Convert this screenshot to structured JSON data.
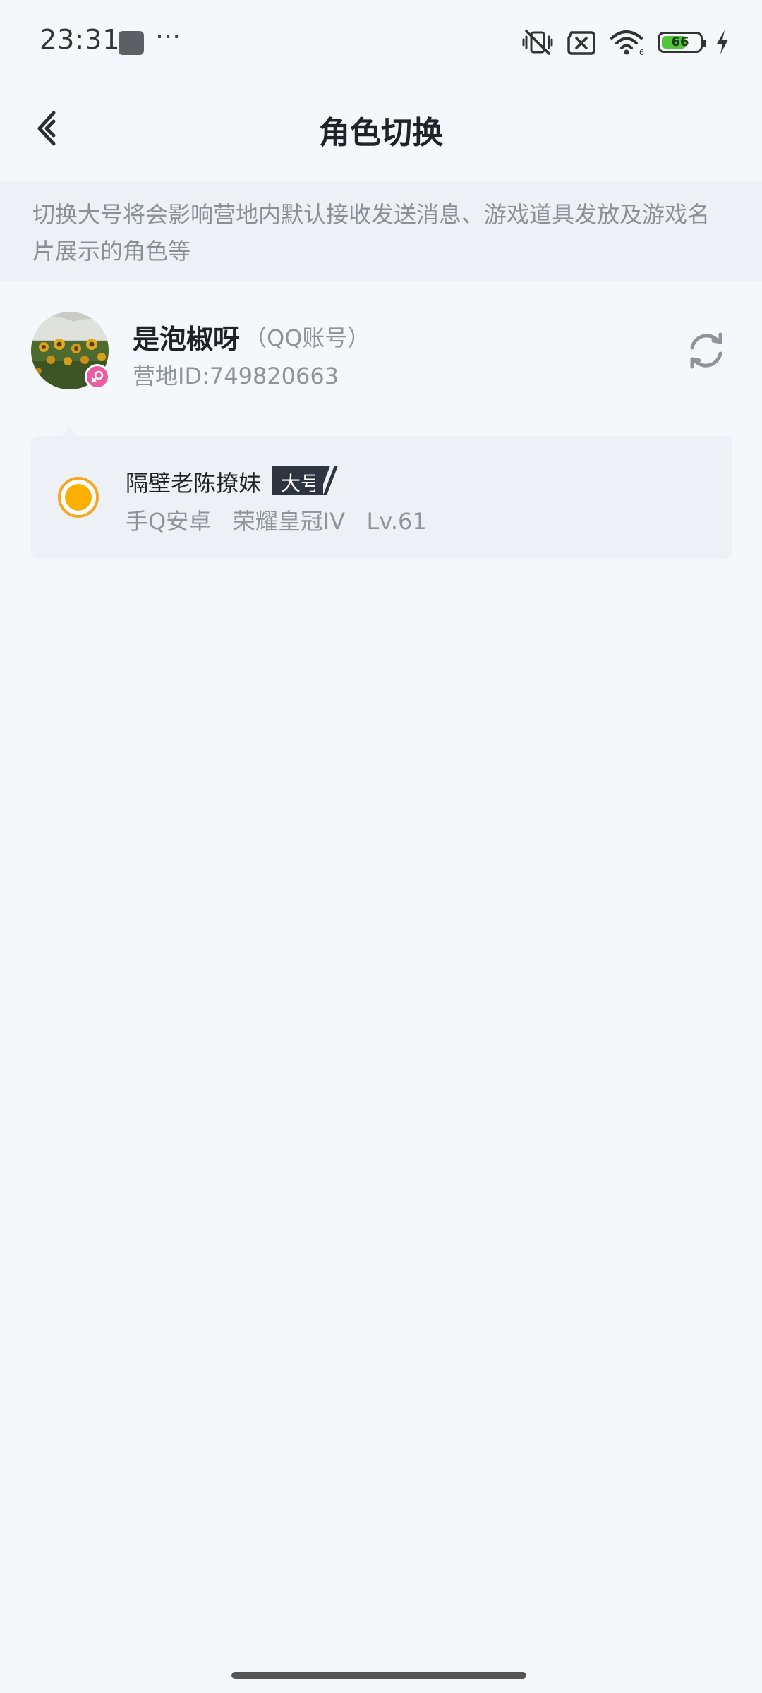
{
  "status_bar": {
    "time": "23:31",
    "dots": "···",
    "battery_level": "66",
    "battery_percent": 66,
    "icons": [
      "app-square-icon",
      "vibrate-off-icon",
      "sim-off-icon",
      "wifi-icon",
      "battery-icon",
      "charging-icon"
    ]
  },
  "header": {
    "title": "角色切换",
    "back_icon": "chevron-left-icon"
  },
  "notice": {
    "text": "切换大号将会影响营地内默认接收发送消息、游戏道具发放及游戏名片展示的角色等"
  },
  "account": {
    "name": "是泡椒呀",
    "type": "（QQ账号）",
    "id_text": "营地ID:749820663",
    "gender_icon": "female-icon",
    "switch_icon": "refresh-icon"
  },
  "role": {
    "name": "隔壁老陈撩妹",
    "tag": "大号",
    "info": "手Q安卓   荣耀皇冠IV   Lv.61",
    "selected": true
  },
  "colors": {
    "background": "#f5f8fb",
    "notice_bg": "#edf0f4",
    "accent_yellow": "#fbb000",
    "badge_pink": "#ea5ba0",
    "tag_dark": "#2e3440"
  }
}
